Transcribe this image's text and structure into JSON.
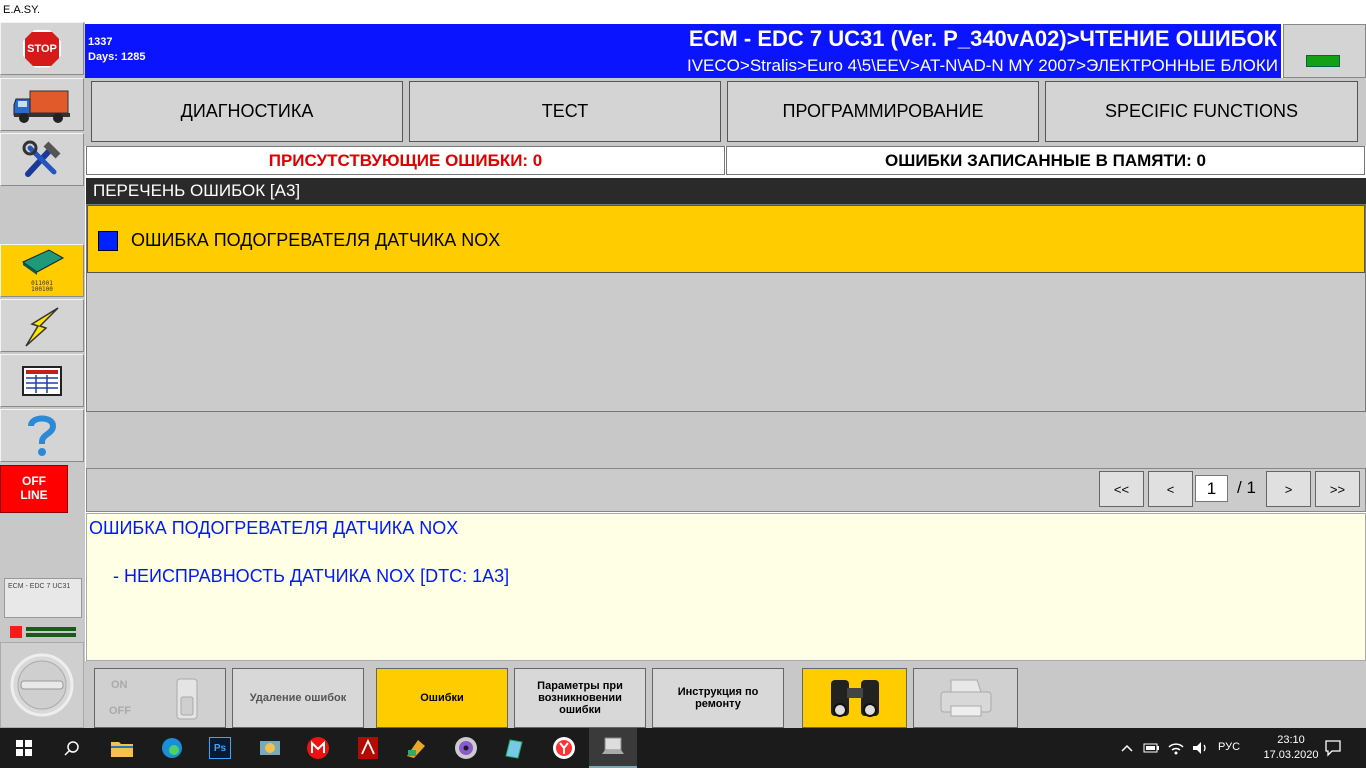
{
  "window": {
    "title": "E.A.SY."
  },
  "sidebar": {
    "stop_label": "STOP",
    "offline_line1": "OFF",
    "offline_line2": "LINE",
    "mini_panel_label": "ECM - EDC 7 UC31",
    "ecu_icon_line1": "011001",
    "ecu_icon_line2": "100100"
  },
  "header": {
    "code": "1337",
    "days": "Days: 1285",
    "title": "ECM - EDC 7 UC31 (Ver. P_340vA02)>ЧТЕНИЕ ОШИБОК",
    "path": "IVECO>Stralis>Euro 4\\5\\EEV>AT-N\\AD-N MY 2007>ЭЛЕКТРОННЫЕ БЛОКИ",
    "status_led_color": "#14a014"
  },
  "tabs": [
    "ДИАГНОСТИКА",
    "ТЕСТ",
    "ПРОГРАММИРОВАНИЕ",
    "SPECIFIC FUNCTIONS"
  ],
  "counters": {
    "present": "ПРИСУТСТВУЮЩИЕ ОШИБКИ: 0",
    "stored": "ОШИБКИ ЗАПИСАННЫЕ В ПАМЯТИ: 0"
  },
  "fault_list": {
    "header": "ПЕРЕЧЕНЬ ОШИБОК [A3]",
    "items": [
      {
        "label": "ОШИБКА ПОДОГРЕВАТЕЛЯ ДАТЧИКА NOX",
        "status_color": "#0022ff"
      }
    ]
  },
  "pager": {
    "first": "<<",
    "prev": "<",
    "page": "1",
    "total": "/ 1",
    "next": ">",
    "last": ">>"
  },
  "detail": {
    "title": "ОШИБКА ПОДОГРЕВАТЕЛЯ ДАТЧИКА NOX",
    "line": "- НЕИСПРАВНОСТЬ ДАТЧИКА NOX [DTC: 1A3]"
  },
  "bottom_bar": {
    "switch_on": "ON",
    "switch_off": "OFF",
    "delete_errors": "Удаление ошибок",
    "errors": "Ошибки",
    "params": "Параметры при возникновении ошибки",
    "repair": "Инструкция по ремонту"
  },
  "taskbar": {
    "language": "РУС",
    "time": "23:10",
    "date": "17.03.2020"
  }
}
